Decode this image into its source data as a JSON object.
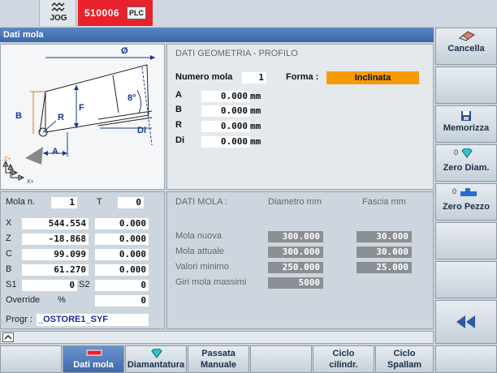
{
  "status": {
    "mode": "JOG",
    "alarm_code": "510006",
    "plc_label": "PLC"
  },
  "window": {
    "title": "Dati mola"
  },
  "diagram": {
    "labels": {
      "diameter": "Ø",
      "B": "B",
      "F": "F",
      "R": "R",
      "A": "A",
      "angle": "8°",
      "Di": "Di",
      "z_axis": "Z+",
      "x_axis": "X+"
    }
  },
  "geometry": {
    "header": "DATI GEOMETRIA - PROFILO",
    "numero_mola_label": "Numero mola",
    "numero_mola": "1",
    "forma_label": "Forma :",
    "forma": "Inclinata",
    "fields": [
      {
        "label": "A",
        "value": "0.000",
        "unit": "mm"
      },
      {
        "label": "B",
        "value": "0.000",
        "unit": "mm"
      },
      {
        "label": "R",
        "value": "0.000",
        "unit": "mm"
      },
      {
        "label": "Di",
        "value": "0.000",
        "unit": "mm"
      }
    ]
  },
  "position": {
    "mola_label": "Mola n.",
    "mola_value": "1",
    "t_label": "T",
    "t_value": "0",
    "axes": [
      {
        "label": "X",
        "value": "544.554",
        "offset": "0.000"
      },
      {
        "label": "Z",
        "value": "-18.868",
        "offset": "0.000"
      },
      {
        "label": "C",
        "value": "99.099",
        "offset": "0.000"
      },
      {
        "label": "B",
        "value": "61.270",
        "offset": "0.000"
      }
    ],
    "s1_label": "S1",
    "s1_value": "0",
    "s2_label": "S2",
    "s2_value": "0",
    "override_label": "Override",
    "override_unit": "%",
    "override_value": "0",
    "progr_label": "Progr :",
    "progr_value": "_OSTORE1_SYF"
  },
  "mola": {
    "header": "DATI MOLA :",
    "col1": "Diametro mm",
    "col2": "Fascia mm",
    "rows": [
      {
        "label": "Mola nuova",
        "diam": "300.000",
        "fascia": "30.000"
      },
      {
        "label": "Mola attuale",
        "diam": "300.000",
        "fascia": "30.000"
      },
      {
        "label": "Valori minimo",
        "diam": "250.000",
        "fascia": "25.000"
      }
    ],
    "giri_label": "Giri mola massimi",
    "giri_value": "5000"
  },
  "softkeys_right": {
    "cancella": "Cancella",
    "memorizza": "Memorizza",
    "zero_diam_prefix": "0",
    "zero_diam": "Zero Diam.",
    "zero_pezzo_prefix": "0",
    "zero_pezzo": "Zero Pezzo"
  },
  "softkeys_bottom": {
    "dati_mola": "Dati mola",
    "diamantatura": "Diamantatura",
    "passata_1": "Passata",
    "passata_2": "Manuale",
    "ciclo_cil_1": "Ciclo",
    "ciclo_cil_2": "cilindr.",
    "ciclo_spa_1": "Ciclo",
    "ciclo_spa_2": "Spallam"
  },
  "colors": {
    "alarm": "#e8212c",
    "forma_highlight": "#f79a06",
    "active_softkey": "#3e69ab",
    "title_bar": "#3a67a8"
  }
}
